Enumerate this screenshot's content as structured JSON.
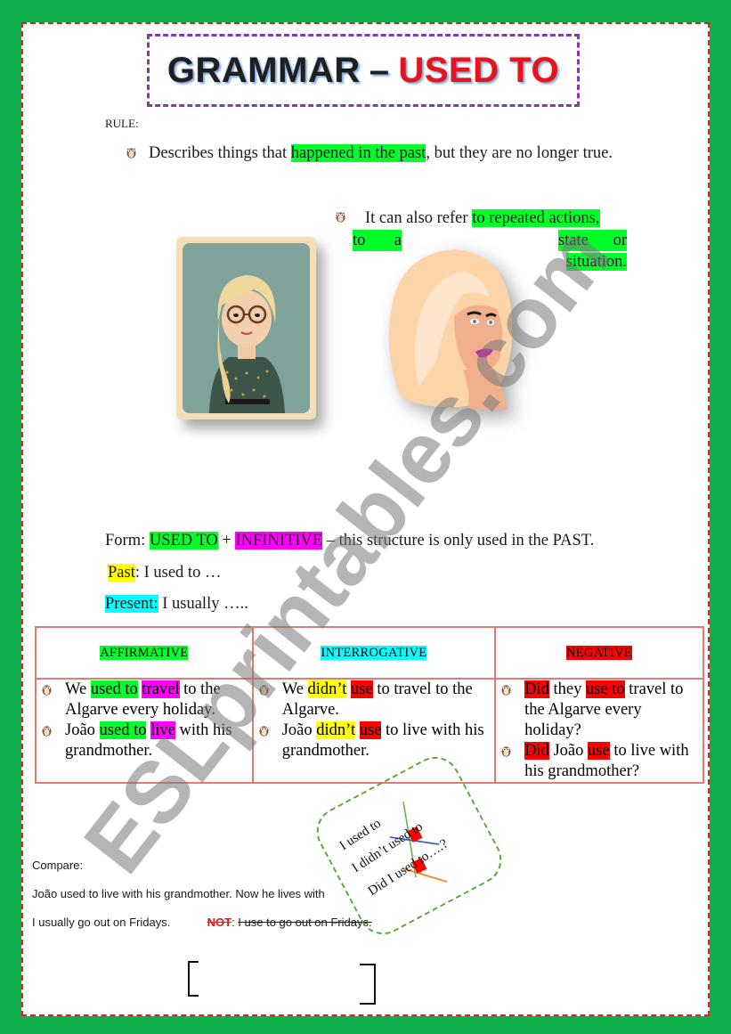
{
  "title": {
    "part1": "GRAMMAR",
    "dash": "–",
    "part2": "USED TO"
  },
  "rule": {
    "label": "RULE:",
    "point1": {
      "before": "Describes things that ",
      "highlight": "happened in the past",
      "after": ", but they are no longer true."
    },
    "point2": {
      "before": "It can also refer ",
      "highlight1": "to repeated actions, to a",
      "highlight2": "state or situation",
      "after": "."
    }
  },
  "images": {
    "picture1": "girl-with-glasses-portrait",
    "picture2": "blonde-woman-illustration"
  },
  "form": {
    "label": "Form: ",
    "used_to": "USED TO",
    "plus": " + ",
    "infinitive": "INFINITIVE",
    "rest": " – this structure is only used in the PAST."
  },
  "past": {
    "label": "Past",
    "text": ": I used to …"
  },
  "present": {
    "label": "Present:",
    "text": " I usually ….."
  },
  "table": {
    "headers": [
      "AFFIRMATIVE",
      "INTERROGATIVE",
      "NEGATIVE"
    ],
    "affirmative": [
      {
        "p1": "We ",
        "h1": "used to",
        "p2": " ",
        "h2": "travel",
        "p3": " to the Algarve every holiday."
      },
      {
        "p1": "João ",
        "h1": "used to",
        "p2": " ",
        "h2": "live",
        "p3": " with his grandmother."
      }
    ],
    "interrogative": [
      {
        "p1": "We ",
        "h1": "didn’t",
        "p2": " ",
        "h2": "use",
        "p3": " to travel to the Algarve."
      },
      {
        "p1": "João ",
        "h1": "didn’t",
        "p2": " ",
        "h2": "use",
        "p3": " to live with his grandmother."
      }
    ],
    "negative": [
      {
        "h1": "Did",
        "p1": " they ",
        "h2": "use to",
        "p2": " travel to the Algarve every holiday?"
      },
      {
        "h1": "Did",
        "p1": " João ",
        "h2": "use",
        "p2": " to live with his grandmother?"
      }
    ]
  },
  "compare": {
    "label": "Compare:",
    "line1": "João used to live with his grandmother. Now he lives with",
    "line2_ok": "I usually go out on Fridays.",
    "not": "NOT",
    "colon": ": ",
    "wrong": "I use to go out on Fridays."
  },
  "card": {
    "line1": "I used to",
    "line2": "I didn’t used to",
    "line3": "Did I used to….?"
  },
  "watermark": "ESLprintables.com",
  "colors": {
    "frame_green": "#0db04b",
    "frame_red_dash": "#d9221c",
    "title_red": "#e8141b",
    "title_box_purple": "#7b3fa6",
    "highlight_green": "#00ff2a",
    "highlight_magenta": "#ff00ff",
    "highlight_yellow": "#ffff00",
    "highlight_cyan": "#00ffff",
    "highlight_red": "#ff0000",
    "table_border": "#e47a75",
    "card_border": "#5aa83a"
  }
}
